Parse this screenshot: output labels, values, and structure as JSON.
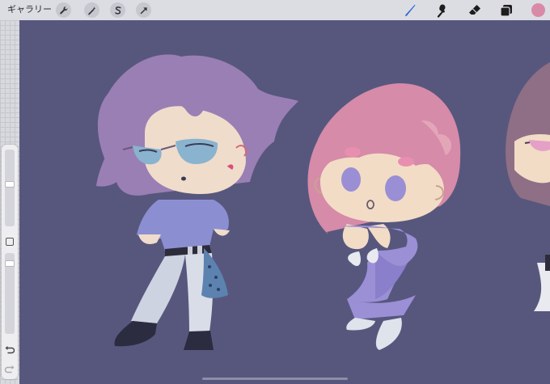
{
  "toolbar": {
    "gallery_label": "ギャラリー",
    "left_tools": [
      "wrench-icon",
      "magic-wand-icon",
      "selection-icon",
      "transform-arrow-icon"
    ],
    "right_tools": [
      "brush-icon",
      "smudge-icon",
      "eraser-icon",
      "layers-icon"
    ],
    "active_tool": "brush-icon",
    "active_tool_color": "#2e6ad6",
    "current_color": "#d98aa6"
  },
  "sidebar": {
    "brush_size_level": 0.55,
    "opacity_level": 0.9,
    "controls": [
      "modify-button",
      "undo-button",
      "redo-button"
    ]
  },
  "canvas": {
    "background_color": "#57577e"
  }
}
